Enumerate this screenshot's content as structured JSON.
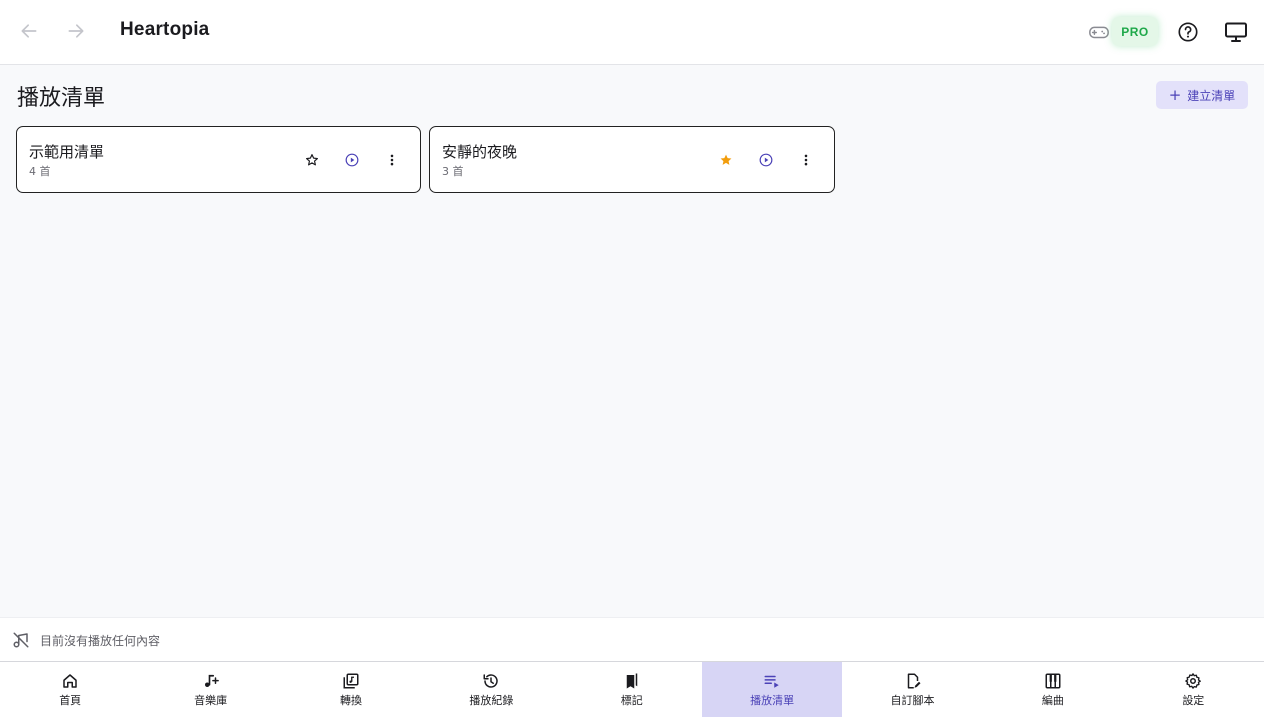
{
  "header": {
    "app_title": "Heartopia",
    "pro_badge": "PRO"
  },
  "page": {
    "title": "播放清單",
    "create_button_label": "建立清單"
  },
  "playlists": [
    {
      "name": "示範用清單",
      "count": "4 首",
      "favorited": false
    },
    {
      "name": "安靜的夜晚",
      "count": "3 首",
      "favorited": true
    }
  ],
  "now_playing": {
    "text": "目前沒有播放任何內容"
  },
  "bottom_nav": {
    "items": [
      {
        "label": "首頁",
        "icon": "home-icon"
      },
      {
        "label": "音樂庫",
        "icon": "music-add-icon"
      },
      {
        "label": "轉換",
        "icon": "convert-icon"
      },
      {
        "label": "播放紀錄",
        "icon": "history-icon"
      },
      {
        "label": "標記",
        "icon": "bookmark-icon"
      },
      {
        "label": "播放清單",
        "icon": "playlist-icon"
      },
      {
        "label": "自訂腳本",
        "icon": "script-edit-icon"
      },
      {
        "label": "編曲",
        "icon": "piano-icon"
      },
      {
        "label": "設定",
        "icon": "gear-icon"
      }
    ],
    "active_index": 5
  },
  "colors": {
    "accent": "#4b42b7",
    "accent_bg": "#d7d5f5",
    "pro_green": "#1fa84a",
    "star_favorite": "#f29d0c"
  }
}
